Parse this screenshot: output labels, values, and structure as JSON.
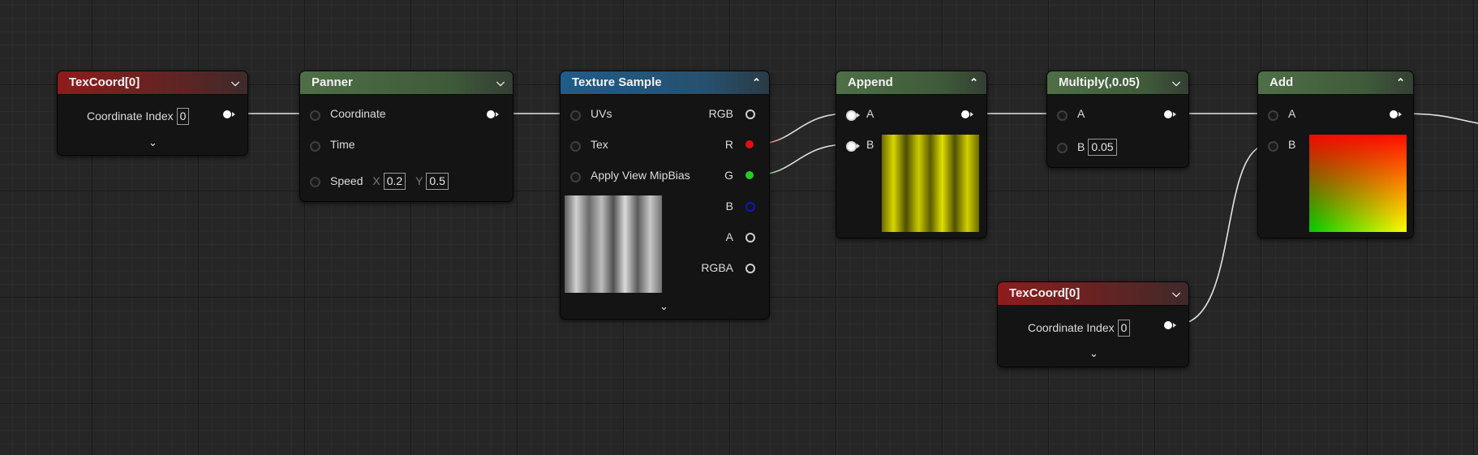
{
  "nodes": {
    "texcoord1": {
      "title": "TexCoord[0]",
      "coord_label": "Coordinate Index",
      "coord_value": "0"
    },
    "panner": {
      "title": "Panner",
      "in_coordinate": "Coordinate",
      "in_time": "Time",
      "in_speed": "Speed",
      "x_label": "X",
      "x_value": "0.2",
      "y_label": "Y",
      "y_value": "0.5"
    },
    "texsample": {
      "title": "Texture Sample",
      "in_uvs": "UVs",
      "in_tex": "Tex",
      "in_mip": "Apply View MipBias",
      "out_rgb": "RGB",
      "out_r": "R",
      "out_g": "G",
      "out_b": "B",
      "out_a": "A",
      "out_rgba": "RGBA"
    },
    "append": {
      "title": "Append",
      "in_a": "A",
      "in_b": "B"
    },
    "multiply": {
      "title": "Multiply(,0.05)",
      "in_a": "A",
      "in_b": "B",
      "b_value": "0.05"
    },
    "add": {
      "title": "Add",
      "in_a": "A",
      "in_b": "B"
    },
    "texcoord2": {
      "title": "TexCoord[0]",
      "coord_label": "Coordinate Index",
      "coord_value": "0"
    }
  },
  "colors": {
    "header_red": "#8e1c1c",
    "header_green": "#4f6f47",
    "header_blue": "#1f5c8a",
    "pin_r": "#e01010",
    "pin_g": "#22cc22",
    "pin_b": "#1515c0"
  },
  "icons": {
    "collapse": "chevron-up-icon",
    "expand": "chevron-down-icon"
  }
}
